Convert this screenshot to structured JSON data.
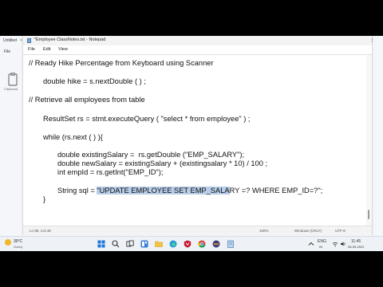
{
  "background_window": {
    "tab_title": "Untitled",
    "tab_close": "×",
    "menu_file": "File",
    "side_label": "Clipboard",
    "controls": {
      "minimize": "—",
      "maximize": "☐",
      "close": "✕"
    }
  },
  "notepad": {
    "title": "*Employee ClassNotes.txt - Notepad",
    "menu": [
      "File",
      "Edit",
      "View"
    ],
    "code_lines": [
      "// Ready Hike Percentage from Keyboard using Scanner",
      "double hike = s.nextDouble ( ) ;",
      "// Retrieve all employees from table",
      "ResultSet rs = stmt.executeQuery ( \"select * from employee\" ) ;",
      "while (rs.next ( ) ){",
      "double existingSalary =  rs.getDouble (\"EMP_SALARY\");",
      "double newSalary = existingSalary + (existingsalary * 10) / 100 ;",
      "int empId = rs.getInt(\"EMP_ID\");",
      "}"
    ],
    "sql_line": {
      "prefix": "String sql = ",
      "highlighted": "\"UPDATE EMPLOYEE SET EMP_SALA",
      "suffix": "RY =? WHERE EMP_ID=?\";"
    },
    "status": {
      "position": "Ln 98, Col 48",
      "zoom": "100%",
      "line_ending": "Windows (CRLF)",
      "encoding": "UTF-8"
    }
  },
  "taskbar": {
    "weather_temp": "30°C",
    "weather_desc": "Sunny",
    "tray_lang": "ENG",
    "tray_region": "IN",
    "time": "11:45",
    "date": "06-09-2022"
  }
}
